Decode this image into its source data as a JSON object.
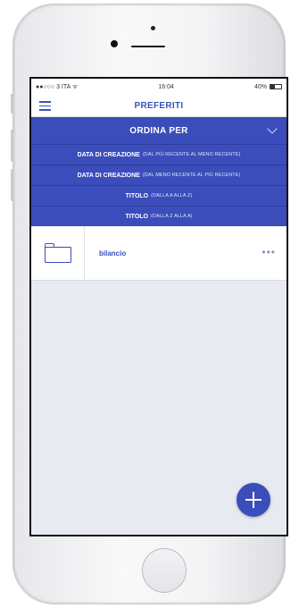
{
  "status_bar": {
    "carrier": "●●○○○ 3 ITA ᯤ",
    "time": "16:04",
    "battery": "40%"
  },
  "nav": {
    "title": "PREFERITI",
    "menu_icon": "hamburger-icon"
  },
  "sort": {
    "header": "ORDINA PER",
    "options": [
      {
        "label": "DATA DI CREAZIONE",
        "detail": "(DAL PIÙ RECENTE AL MENO RECENTE)"
      },
      {
        "label": "DATA DI CREAZIONE",
        "detail": "(DAL MENO RECENTE AL PIÙ RECENTE)"
      },
      {
        "label": "TITOLO",
        "detail": "(DALLA A ALLA Z)"
      },
      {
        "label": "TITOLO",
        "detail": "(DALLA Z ALLA A)"
      }
    ]
  },
  "folders": [
    {
      "name": "bilancio",
      "icon": "folder-icon",
      "more": "•••"
    }
  ],
  "colors": {
    "accent": "#3a4dbb",
    "screen_bg": "#e8eaf2"
  }
}
